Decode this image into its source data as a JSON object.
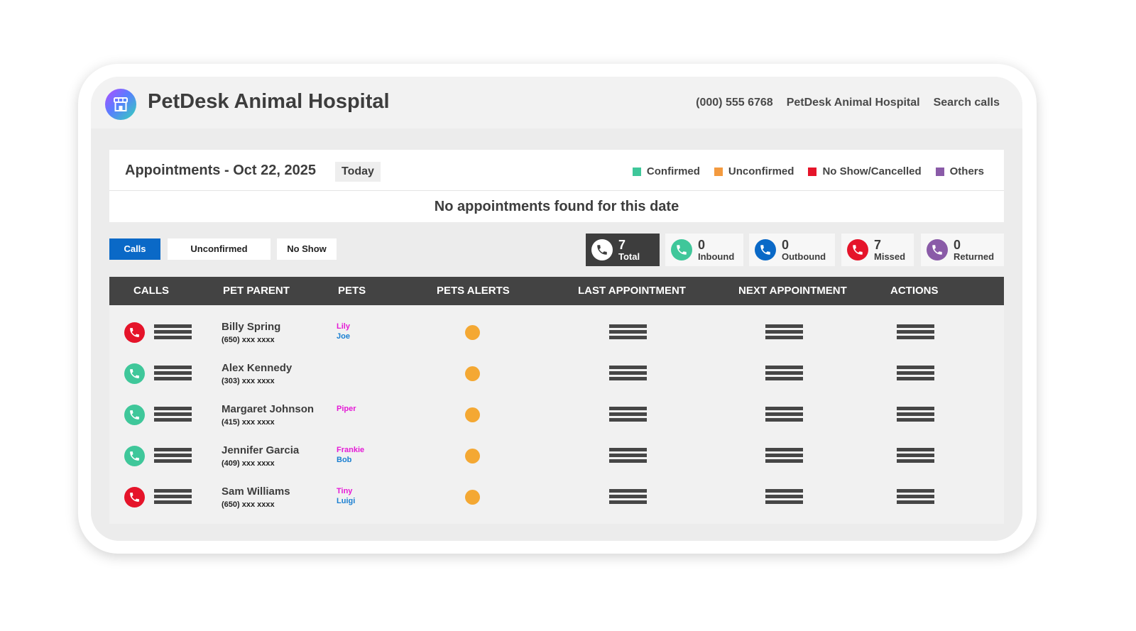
{
  "app": {
    "title": "PetDesk Animal Hospital",
    "logo_icon": "storefront-icon"
  },
  "topbar": {
    "phone": "(000) 555 6768",
    "hospital": "PetDesk Animal Hospital",
    "search": "Search calls"
  },
  "appointments": {
    "title": "Appointments - Oct 22, 2025",
    "today_label": "Today",
    "empty_message": "No appointments found for this date",
    "legend": [
      {
        "label": "Confirmed",
        "color": "#3fc79a"
      },
      {
        "label": "Unconfirmed",
        "color": "#f39a3f"
      },
      {
        "label": "No Show/Cancelled",
        "color": "#e5142a"
      },
      {
        "label": "Others",
        "color": "#8a5ba8"
      }
    ]
  },
  "filters": [
    {
      "label": "Calls",
      "active": true
    },
    {
      "label": "Unconfirmed",
      "active": false
    },
    {
      "label": "No Show",
      "active": false
    }
  ],
  "stats": [
    {
      "count": "7",
      "label": "Total",
      "color": "#3d3d3d",
      "icon": "phone-icon"
    },
    {
      "count": "0",
      "label": "Inbound",
      "color": "#3fc79a",
      "icon": "phone-inbound-icon"
    },
    {
      "count": "0",
      "label": "Outbound",
      "color": "#0a69c7",
      "icon": "phone-outbound-icon"
    },
    {
      "count": "7",
      "label": "Missed",
      "color": "#e5142a",
      "icon": "phone-missed-icon"
    },
    {
      "count": "0",
      "label": "Returned",
      "color": "#8a5ba8",
      "icon": "phone-returned-icon"
    }
  ],
  "table": {
    "columns": [
      "CALLS",
      "PET PARENT",
      "PETS",
      "PETS ALERTS",
      "LAST APPOINTMENT",
      "NEXT APPOINTMENT",
      "ACTIONS"
    ],
    "rows": [
      {
        "call_status": "missed",
        "call_color": "#e5142a",
        "name": "Billy Spring",
        "phone": "(650) xxx xxxx",
        "pets": [
          "Lily",
          "Joe"
        ]
      },
      {
        "call_status": "answered",
        "call_color": "#3fc79a",
        "name": "Alex Kennedy",
        "phone": "(303) xxx xxxx",
        "pets": []
      },
      {
        "call_status": "answered",
        "call_color": "#3fc79a",
        "name": "Margaret Johnson",
        "phone": "(415) xxx xxxx",
        "pets": [
          "Piper"
        ]
      },
      {
        "call_status": "answered",
        "call_color": "#3fc79a",
        "name": "Jennifer Garcia",
        "phone": "(409) xxx xxxx",
        "pets": [
          "Frankie",
          "Bob"
        ]
      },
      {
        "call_status": "missed",
        "call_color": "#e5142a",
        "name": "Sam Williams",
        "phone": "(650) xxx xxxx",
        "pets": [
          "Tiny",
          "Luigi"
        ]
      }
    ],
    "alert_color": "#f4a833"
  }
}
